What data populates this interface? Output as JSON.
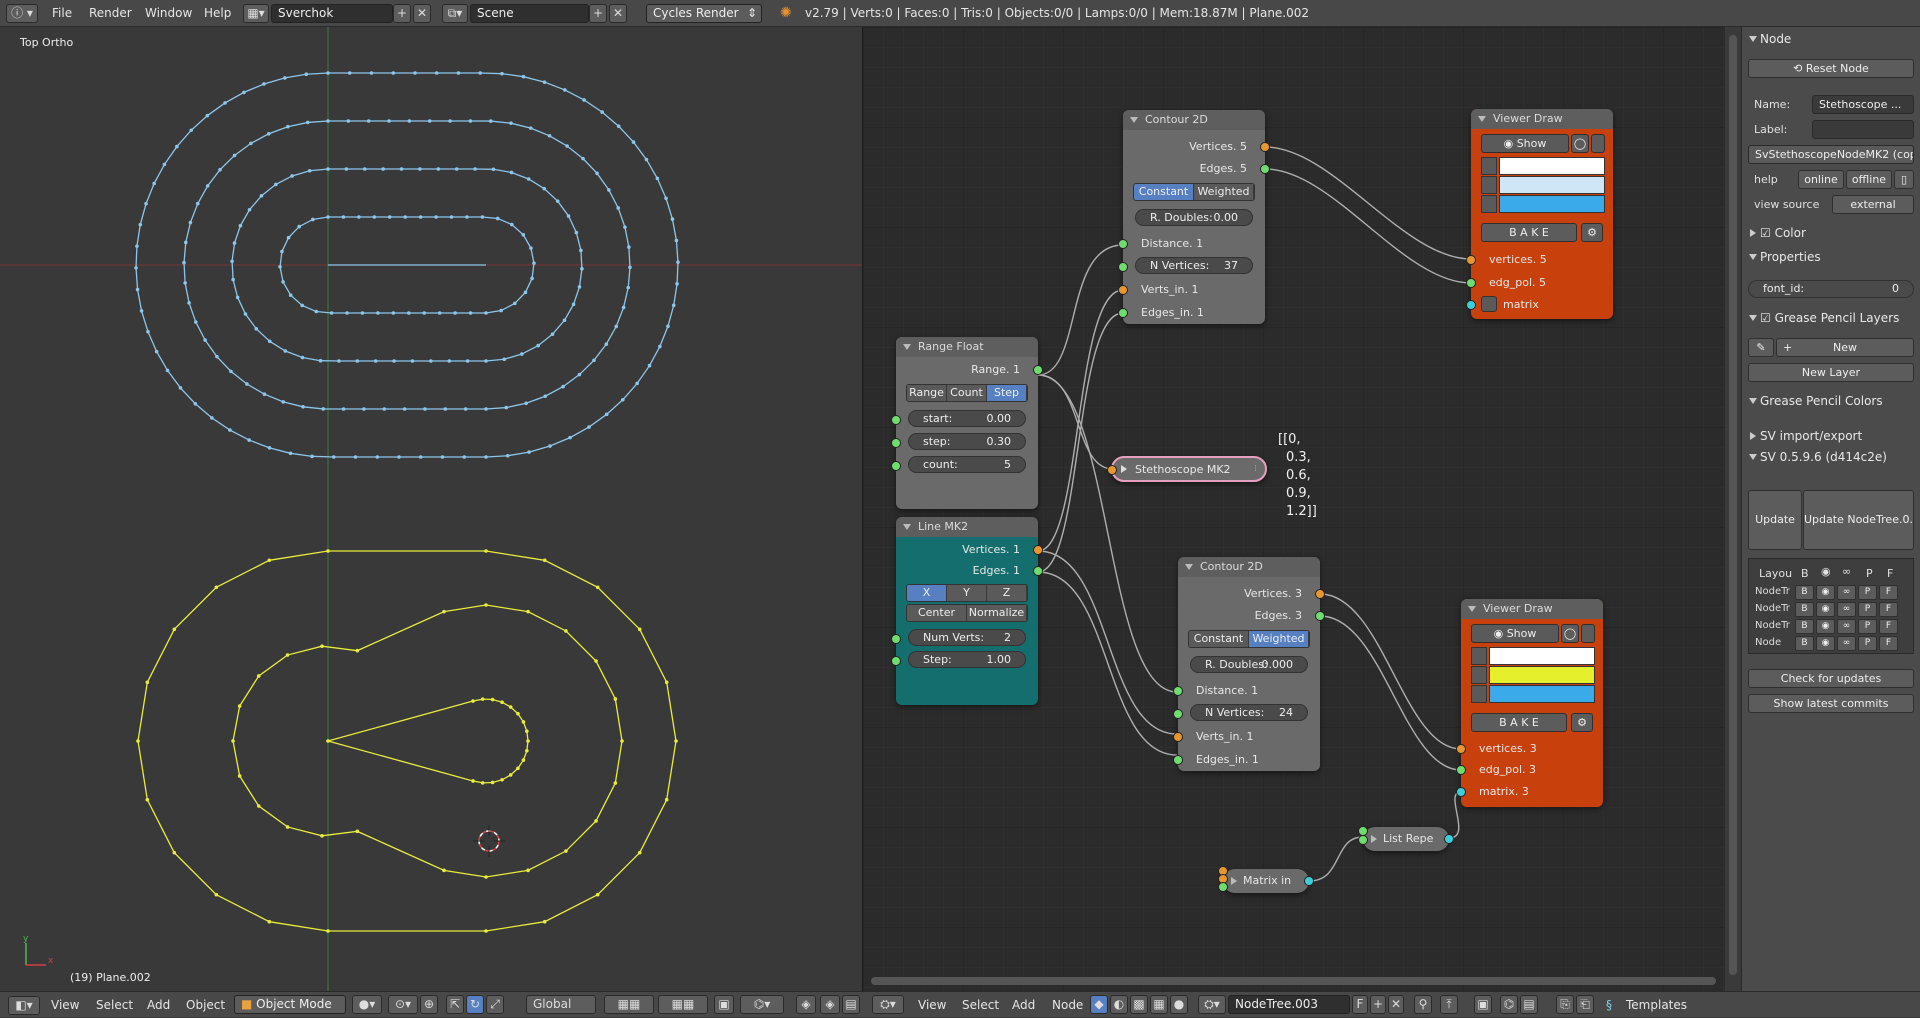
{
  "topbar": {
    "menus": [
      "File",
      "Render",
      "Window",
      "Help"
    ],
    "screen_name": "Sverchok",
    "scene_name": "Scene",
    "render_engine": "Cycles Render",
    "stats": "v2.79 | Verts:0 | Faces:0 | Tris:0 | Objects:0/0 | Lamps:0/0 | Mem:18.87M | Plane.002"
  },
  "viewport": {
    "view_label": "Top Ortho",
    "object_label": "(19) Plane.002",
    "colors": {
      "blue_curve": "#8cc6ea",
      "yellow_curve": "#e8ec3c",
      "x_axis": "#8a3535",
      "y_axis": "#3f8a3f"
    }
  },
  "nodes": {
    "contour_top": {
      "title": "Contour 2D",
      "out_vertices": "Vertices. 5",
      "out_edges": "Edges. 5",
      "mode_constant": "Constant",
      "mode_weighted": "Weighted",
      "r_doubles_label": "R. Doubles:",
      "r_doubles_value": "0.00",
      "in_distance": "Distance. 1",
      "n_vertices_label": "N Vertices:",
      "n_vertices_value": "37",
      "in_verts": "Verts_in. 1",
      "in_edges": "Edges_in. 1"
    },
    "range_float": {
      "title": "Range Float",
      "out_range": "Range. 1",
      "modes": [
        "Range",
        "Count",
        "Step"
      ],
      "start_label": "start:",
      "start_value": "0.00",
      "step_label": "step:",
      "step_value": "0.30",
      "count_label": "count:",
      "count_value": "5"
    },
    "line_mk2": {
      "title": "Line MK2",
      "out_vertices": "Vertices. 1",
      "out_edges": "Edges. 1",
      "axes": [
        "X",
        "Y",
        "Z"
      ],
      "center": "Center",
      "normalize": "Normalize",
      "num_verts_label": "Num Verts:",
      "num_verts_value": "2",
      "step_label": "Step:",
      "step_value": "1.00"
    },
    "stethoscope": {
      "title": "Stethoscope MK2",
      "output_lines": [
        "[[0,",
        "0.3,",
        "0.6,",
        "0.9,",
        "1.2]]"
      ]
    },
    "contour_bottom": {
      "title": "Contour 2D",
      "out_vertices": "Vertices. 3",
      "out_edges": "Edges. 3",
      "mode_constant": "Constant",
      "mode_weighted": "Weighted",
      "r_doubles_label": "R. Doubles:",
      "r_doubles_value": "0.000",
      "in_distance": "Distance. 1",
      "n_vertices_label": "N Vertices:",
      "n_vertices_value": "24",
      "in_verts": "Verts_in. 1",
      "in_edges": "Edges_in. 1"
    },
    "viewer_top": {
      "title": "Viewer Draw",
      "show": "Show",
      "bake": "B A K E",
      "in_vertices": "vertices. 5",
      "in_edges": "edg_pol. 5",
      "in_matrix": "matrix",
      "swatches": [
        "#ffffff",
        "#cfe6f7",
        "#3aaaea"
      ]
    },
    "viewer_bottom": {
      "title": "Viewer Draw",
      "show": "Show",
      "bake": "B A K E",
      "in_vertices": "vertices. 3",
      "in_edges": "edg_pol. 3",
      "in_matrix": "matrix. 3",
      "swatches": [
        "#ffffff",
        "#e6ef2c",
        "#3aaaea"
      ]
    },
    "list_repeater": {
      "title": "List Repe"
    },
    "matrix_in": {
      "title": "Matrix in"
    }
  },
  "sidebar": {
    "node_header": "Node",
    "reset_node": "Reset Node",
    "name_label": "Name:",
    "name_value": "Stethoscope ...",
    "label_label": "Label:",
    "label_value": "",
    "idname": "SvStethoscopeNodeMK2 (copy)",
    "help_label": "help",
    "online": "online",
    "offline": "offline",
    "view_source_label": "view source",
    "external": "external",
    "color_header": "Color",
    "properties_header": "Properties",
    "font_id_label": "font_id:",
    "font_id_value": "0",
    "gp_layers_header": "Grease Pencil Layers",
    "new_btn": "New",
    "new_layer": "New Layer",
    "gp_colors_header": "Grease Pencil Colors",
    "sv_import_header": "SV import/export",
    "sv_version_header": "SV 0.5.9.6 (d414c2e)",
    "update_all": "Update all",
    "update_nodetree": "Update NodeTree.0...",
    "layout_cols": [
      "Layou",
      "B",
      "P",
      "F"
    ],
    "layout_rows": [
      "NodeTr",
      "NodeTr",
      "NodeTr",
      "Node"
    ],
    "check_updates": "Check for updates",
    "show_commits": "Show latest commits"
  },
  "bottombar": {
    "left_menus": [
      "View",
      "Select",
      "Add",
      "Object"
    ],
    "mode": "Object Mode",
    "orientation": "Global",
    "right_menus": [
      "View",
      "Select",
      "Add",
      "Node"
    ],
    "nodetree": "NodeTree.003",
    "fake_user": "F",
    "templates": "Templates"
  }
}
